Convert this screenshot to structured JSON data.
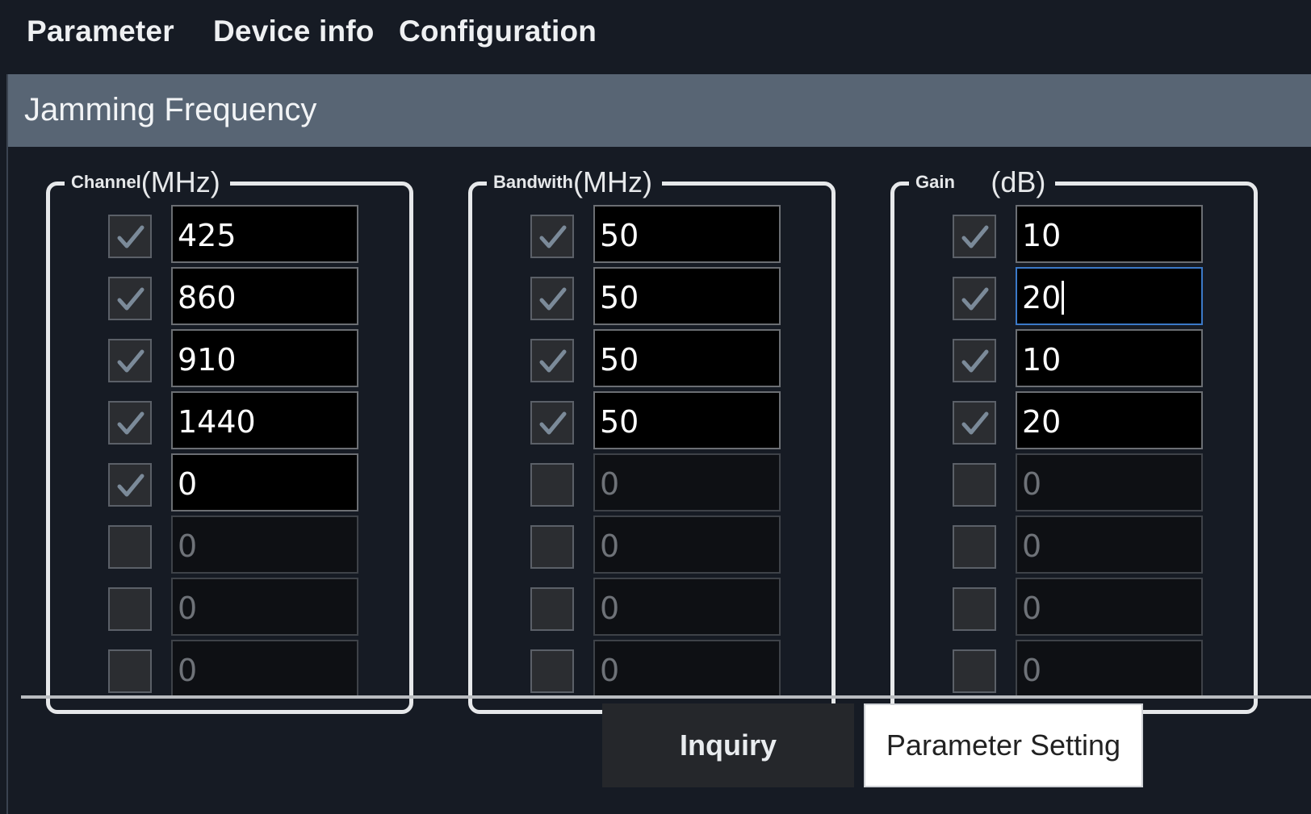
{
  "menu": [
    "Parameter",
    "Device info",
    "Configuration"
  ],
  "panel_title": "Jamming Frequency",
  "groups": [
    {
      "title_small": "Channel",
      "title_unit": "(MHz)",
      "rows": [
        {
          "checked": true,
          "value": "425",
          "enabled": true
        },
        {
          "checked": true,
          "value": "860",
          "enabled": true
        },
        {
          "checked": true,
          "value": "910",
          "enabled": true
        },
        {
          "checked": true,
          "value": "1440",
          "enabled": true
        },
        {
          "checked": true,
          "value": "0",
          "enabled": true
        },
        {
          "checked": false,
          "value": "0",
          "enabled": false
        },
        {
          "checked": false,
          "value": "0",
          "enabled": false
        },
        {
          "checked": false,
          "value": "0",
          "enabled": false
        }
      ]
    },
    {
      "title_small": "Bandwith",
      "title_unit": "(MHz)",
      "rows": [
        {
          "checked": true,
          "value": "50",
          "enabled": true
        },
        {
          "checked": true,
          "value": "50",
          "enabled": true
        },
        {
          "checked": true,
          "value": "50",
          "enabled": true
        },
        {
          "checked": true,
          "value": "50",
          "enabled": true
        },
        {
          "checked": false,
          "value": "0",
          "enabled": false
        },
        {
          "checked": false,
          "value": "0",
          "enabled": false
        },
        {
          "checked": false,
          "value": "0",
          "enabled": false
        },
        {
          "checked": false,
          "value": "0",
          "enabled": false
        }
      ]
    },
    {
      "title_small": "Gain",
      "title_unit": "(dB)",
      "rows": [
        {
          "checked": true,
          "value": "10",
          "enabled": true
        },
        {
          "checked": true,
          "value": "20",
          "enabled": true,
          "focused": true
        },
        {
          "checked": true,
          "value": "10",
          "enabled": true
        },
        {
          "checked": true,
          "value": "20",
          "enabled": true
        },
        {
          "checked": false,
          "value": "0",
          "enabled": false
        },
        {
          "checked": false,
          "value": "0",
          "enabled": false
        },
        {
          "checked": false,
          "value": "0",
          "enabled": false
        },
        {
          "checked": false,
          "value": "0",
          "enabled": false
        }
      ]
    }
  ],
  "buttons": {
    "inquiry": "Inquiry",
    "parameter_setting": "Parameter Setting"
  },
  "colors": {
    "header": "#586574",
    "background": "#161b24",
    "checkmark": "#7b8a99",
    "focus_border": "#3b79c8"
  },
  "icons": {
    "checkbox_checked": "check-icon"
  }
}
